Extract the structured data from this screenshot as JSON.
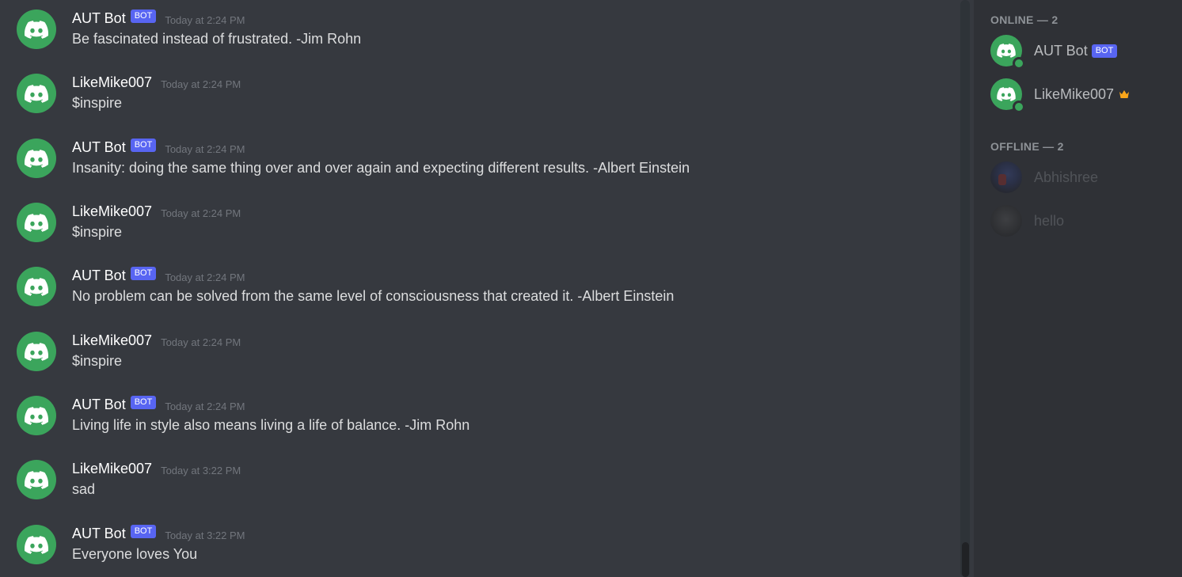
{
  "messages": [
    {
      "author": "AUT Bot",
      "bot": true,
      "bot_tag": "BOT",
      "time": "Today at 2:24 PM",
      "text": "Be fascinated instead of frustrated. -Jim Rohn"
    },
    {
      "author": "LikeMike007",
      "bot": false,
      "bot_tag": "",
      "time": "Today at 2:24 PM",
      "text": "$inspire"
    },
    {
      "author": "AUT Bot",
      "bot": true,
      "bot_tag": "BOT",
      "time": "Today at 2:24 PM",
      "text": "Insanity: doing the same thing over and over again and expecting different results. -Albert Einstein"
    },
    {
      "author": "LikeMike007",
      "bot": false,
      "bot_tag": "",
      "time": "Today at 2:24 PM",
      "text": "$inspire"
    },
    {
      "author": "AUT Bot",
      "bot": true,
      "bot_tag": "BOT",
      "time": "Today at 2:24 PM",
      "text": "No problem can be solved from the same level of consciousness that created it. -Albert Einstein"
    },
    {
      "author": "LikeMike007",
      "bot": false,
      "bot_tag": "",
      "time": "Today at 2:24 PM",
      "text": "$inspire"
    },
    {
      "author": "AUT Bot",
      "bot": true,
      "bot_tag": "BOT",
      "time": "Today at 2:24 PM",
      "text": "Living life in style also means living a life of balance. -Jim Rohn"
    },
    {
      "author": "LikeMike007",
      "bot": false,
      "bot_tag": "",
      "time": "Today at 3:22 PM",
      "text": "sad"
    },
    {
      "author": "AUT Bot",
      "bot": true,
      "bot_tag": "BOT",
      "time": "Today at 3:22 PM",
      "text": "Everyone loves You"
    }
  ],
  "members": {
    "online_title": "ONLINE — 2",
    "offline_title": "OFFLINE — 2",
    "online": [
      {
        "name": "AUT Bot",
        "tag": "BOT"
      },
      {
        "name": "LikeMike007",
        "icon": "crown-icon"
      }
    ],
    "offline": [
      {
        "name": "Abhishree"
      },
      {
        "name": "hello"
      }
    ]
  },
  "colors": {
    "background": "#36393f",
    "member_list": "#2f3136",
    "avatar_green": "#3ba55c",
    "bot_tag": "#5865f2",
    "crown": "#faa61a"
  }
}
